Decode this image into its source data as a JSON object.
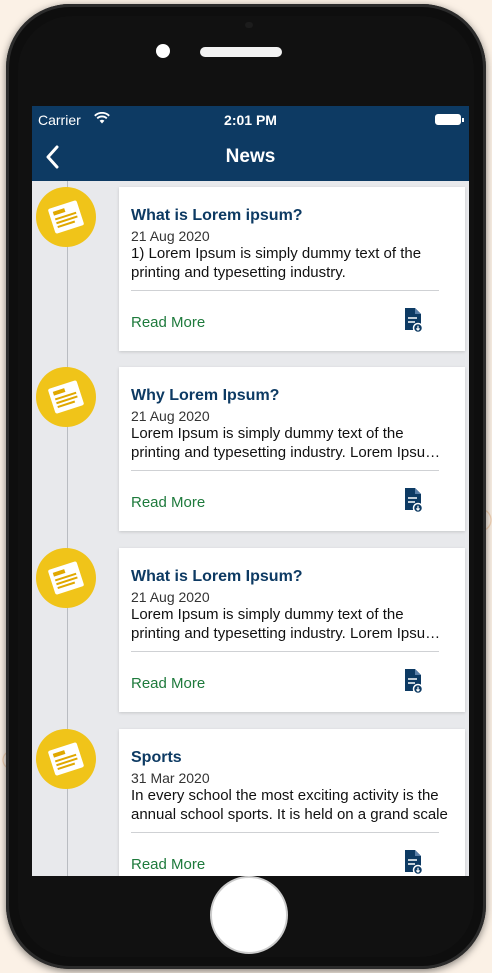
{
  "status_bar": {
    "carrier": "Carrier",
    "time": "2:01 PM"
  },
  "nav": {
    "title": "News",
    "back_icon": "chevron-left-icon"
  },
  "news": [
    {
      "title": "What is Lorem ipsum?",
      "date": "21 Aug 2020",
      "description": "1) Lorem Ipsum is simply dummy text of the printing and typesetting industry.",
      "read_more": "Read More"
    },
    {
      "title": "Why Lorem Ipsum?",
      "date": "21 Aug 2020",
      "description": "Lorem Ipsum is simply dummy text of the printing and typesetting industry. Lorem Ipsum has been the industry's standard dummy text",
      "read_more": "Read More"
    },
    {
      "title": "What is Lorem Ipsum?",
      "date": "21 Aug 2020",
      "description": "Lorem Ipsum is simply dummy text of the printing and typesetting industry. Lorem Ipsum has been the industry's standard dummy text",
      "read_more": "Read More"
    },
    {
      "title": "Sports",
      "date": "31 Mar 2020",
      "description": "In every school the most exciting activity is the annual school sports. It is held on a grand scale",
      "read_more": "Read More"
    }
  ],
  "colors": {
    "nav_bg": "#0d3a63",
    "badge": "#f0c419",
    "title": "#0d3a63",
    "read_more": "#1e7a3c"
  }
}
